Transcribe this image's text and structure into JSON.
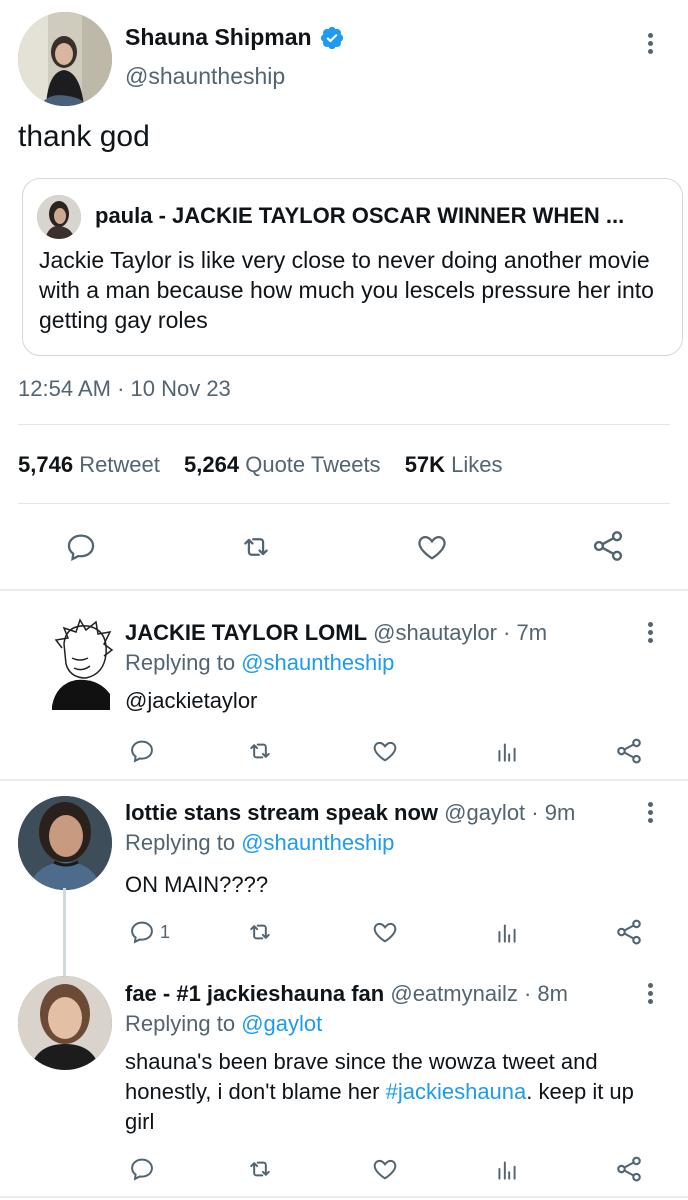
{
  "tweet": {
    "display_name": "Shauna Shipman",
    "handle": "@shauntheship",
    "text": "thank god",
    "quote": {
      "author": "paula - JACKIE TAYLOR OSCAR WINNER WHEN ...",
      "text": "Jackie Taylor is like very close to never doing another movie with a man because how much you lescels pressure her into getting gay roles"
    },
    "timestamp": "12:54 AM · 10 Nov 23",
    "stats": {
      "retweets": "5,746",
      "retweets_label": "Retweet",
      "quotes": "5,264",
      "quotes_label": "Quote Tweets",
      "likes": "57K",
      "likes_label": "Likes"
    }
  },
  "replies": [
    {
      "name": "JACKIE TAYLOR LOML",
      "handle": "@shautaylor",
      "time": "· 7m",
      "replying_prefix": "Replying to",
      "replying_to": "@shauntheship",
      "text": "@jackietaylor"
    },
    {
      "name": "lottie stans stream speak now",
      "handle": "@gaylot",
      "time": "· 9m",
      "replying_prefix": "Replying to",
      "replying_to": "@shauntheship",
      "text": "ON MAIN????",
      "reply_count": "1"
    },
    {
      "name": "fae - #1 jackieshauna fan",
      "handle": "@eatmynailz",
      "time": "· 8m",
      "replying_prefix": "Replying to",
      "replying_to": "@gaylot",
      "text_before": "shauna's been brave since the wowza tweet and honestly, i don't blame her ",
      "hashtag": "#jackieshauna",
      "text_after": ". keep it up girl"
    }
  ],
  "colors": {
    "accent": "#1d9bf0",
    "muted": "#536471",
    "text": "#0f1419",
    "border": "#cfd9de"
  },
  "icons": [
    "verified-badge-icon",
    "more-icon",
    "reply-icon",
    "retweet-icon",
    "like-icon",
    "share-icon",
    "analytics-icon"
  ]
}
